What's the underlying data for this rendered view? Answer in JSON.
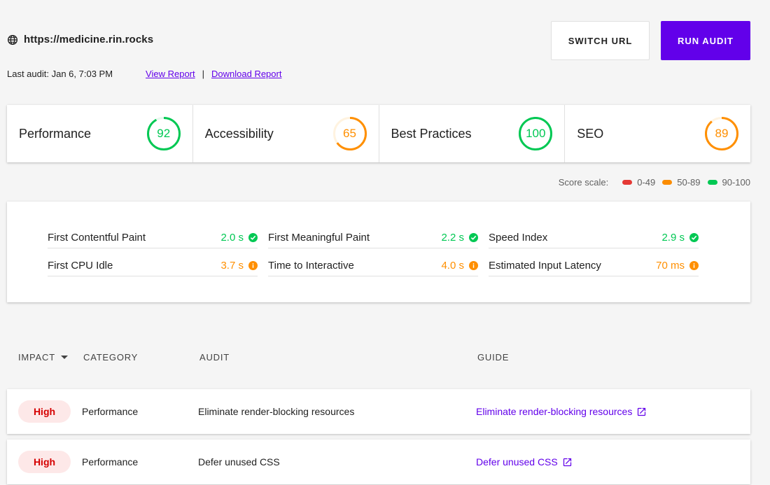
{
  "header": {
    "url": "https://medicine.rin.rocks",
    "last_audit": "Last audit: Jan 6, 7:03 PM",
    "view_report": "View Report ",
    "separator": "|",
    "download_report": "Download Report",
    "switch_url_label": "SWITCH URL",
    "run_audit_label": "RUN AUDIT"
  },
  "scores": [
    {
      "name": "Performance",
      "value": "92",
      "percent": 92,
      "color": "#00c853",
      "bg": "#e8f8ee"
    },
    {
      "name": "Accessibility",
      "value": "65",
      "percent": 65,
      "color": "#ff8f00",
      "bg": "#fff3e0"
    },
    {
      "name": "Best Practices",
      "value": "100",
      "percent": 100,
      "color": "#00c853",
      "bg": "#e8f8ee"
    },
    {
      "name": "SEO",
      "value": "89",
      "percent": 89,
      "color": "#ff8f00",
      "bg": "#fff3e0"
    }
  ],
  "scale": {
    "label": "Score scale:",
    "items": [
      {
        "label": "0-49",
        "color": "#e53935"
      },
      {
        "label": "50-89",
        "color": "#fb8c00"
      },
      {
        "label": "90-100",
        "color": "#00c853"
      }
    ]
  },
  "metrics": [
    {
      "name": "First Contentful Paint",
      "value": "2.0 s",
      "status": "pass"
    },
    {
      "name": "First Meaningful Paint",
      "value": "2.2 s",
      "status": "pass"
    },
    {
      "name": "Speed Index",
      "value": "2.9 s",
      "status": "pass"
    },
    {
      "name": "First CPU Idle",
      "value": "3.7 s",
      "status": "average"
    },
    {
      "name": "Time to Interactive",
      "value": "4.0 s",
      "status": "average"
    },
    {
      "name": "Estimated Input Latency",
      "value": "70 ms",
      "status": "average"
    }
  ],
  "colors": {
    "pass": "#00c853",
    "average": "#ff8f00",
    "accent": "#6200ea"
  },
  "table": {
    "headers": {
      "impact": "IMPACT",
      "category": "CATEGORY",
      "audit": "AUDIT",
      "guide": "GUIDE"
    },
    "rows": [
      {
        "impact": "High",
        "category": "Performance",
        "audit": "Eliminate render-blocking resources",
        "guide": "Eliminate render-blocking resources"
      },
      {
        "impact": "High",
        "category": "Performance",
        "audit": "Defer unused CSS",
        "guide": "Defer unused CSS"
      }
    ]
  }
}
